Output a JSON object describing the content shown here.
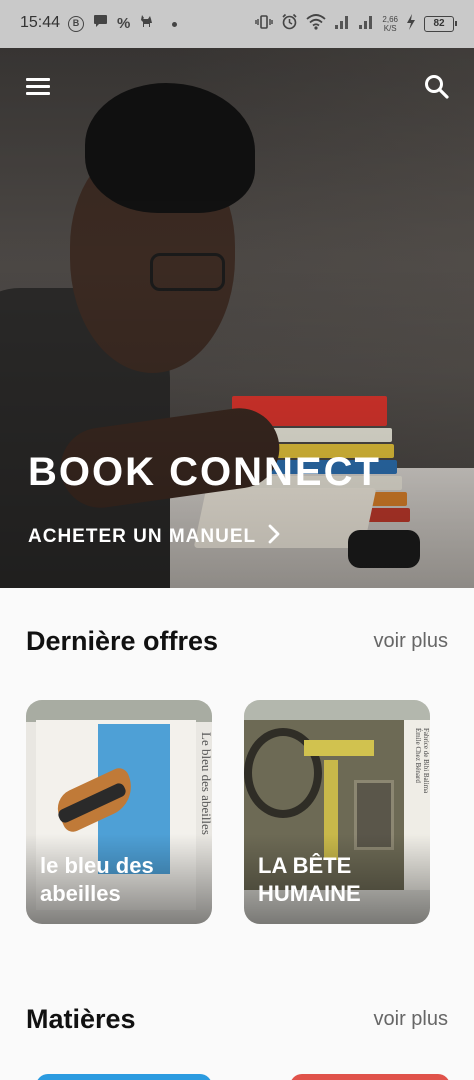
{
  "status_bar": {
    "time": "15:44",
    "left_icons": [
      "b-circle-icon",
      "chat-icon",
      "percent-icon",
      "deer-icon"
    ],
    "net_speed": "2,66\nK/S",
    "battery": "82"
  },
  "hero": {
    "title": "BOOK CONNECT",
    "cta_label": "ACHETER UN MANUEL"
  },
  "offers": {
    "title": "Dernière offres",
    "see_more": "voir plus",
    "books": [
      {
        "caption": "le bleu des abeilles",
        "spine_text": "Le bleu des abeilles"
      },
      {
        "caption": "LA BÊTE HUMAINE",
        "spine_text": "Fabrice de Bibi Balima\nÉmile Chez Bénard"
      }
    ]
  },
  "subjects": {
    "title": "Matières",
    "see_more": "voir plus"
  },
  "colors": {
    "accent_blue": "#2b9be0",
    "accent_red": "#e0524a",
    "statusbar": "#c9c9c9"
  }
}
